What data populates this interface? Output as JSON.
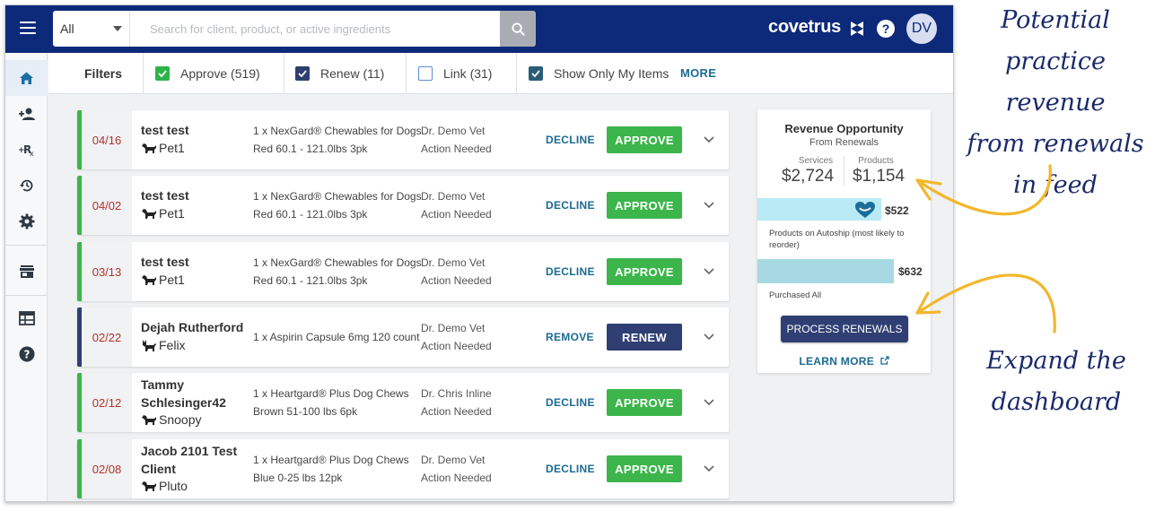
{
  "header": {
    "search_scope": "All",
    "search_placeholder": "Search for client, product, or active ingredients",
    "brand": "covetrus",
    "help_label": "?",
    "avatar_initials": "DV"
  },
  "filters": {
    "label": "Filters",
    "items": [
      {
        "label": "Approve (519)",
        "checked": true
      },
      {
        "label": "Renew (11)",
        "checked": true
      },
      {
        "label": "Link (31)",
        "checked": false
      },
      {
        "label": "Show Only My Items",
        "checked": true
      }
    ],
    "more": "MORE"
  },
  "rows": [
    {
      "date": "04/16",
      "client": "test test",
      "pet": "Pet1",
      "pet_type": "dog",
      "product1": "1 x NexGard® Chewables for Dogs",
      "product2": "Red 60.1 - 121.0lbs 3pk",
      "vet": "Dr. Demo Vet",
      "status": "Action Needed",
      "link": "DECLINE",
      "action": "APPROVE",
      "kind": "approve"
    },
    {
      "date": "04/02",
      "client": "test test",
      "pet": "Pet1",
      "pet_type": "dog",
      "product1": "1 x NexGard® Chewables for Dogs",
      "product2": "Red 60.1 - 121.0lbs 3pk",
      "vet": "Dr. Demo Vet",
      "status": "Action Needed",
      "link": "DECLINE",
      "action": "APPROVE",
      "kind": "approve"
    },
    {
      "date": "03/13",
      "client": "test test",
      "pet": "Pet1",
      "pet_type": "dog",
      "product1": "1 x NexGard® Chewables for Dogs",
      "product2": "Red 60.1 - 121.0lbs 3pk",
      "vet": "Dr. Demo Vet",
      "status": "Action Needed",
      "link": "DECLINE",
      "action": "APPROVE",
      "kind": "approve"
    },
    {
      "date": "02/22",
      "client": "Dejah Rutherford",
      "pet": "Felix",
      "pet_type": "cat",
      "product1": "1 x Aspirin Capsule 6mg 120 count",
      "product2": "",
      "vet": "Dr. Demo Vet",
      "status": "Action Needed",
      "link": "REMOVE",
      "action": "RENEW",
      "kind": "renew"
    },
    {
      "date": "02/12",
      "client": "Tammy Schlesinger42",
      "pet": "Snoopy",
      "pet_type": "dog",
      "product1": "1 x Heartgard® Plus Dog Chews",
      "product2": "Brown 51-100 lbs 6pk",
      "vet": "Dr. Chris Inline",
      "status": "Action Needed",
      "link": "DECLINE",
      "action": "APPROVE",
      "kind": "approve"
    },
    {
      "date": "02/08",
      "client": "Jacob 2101 Test Client",
      "pet": "Pluto",
      "pet_type": "dog",
      "product1": "1 x Heartgard® Plus Dog Chews",
      "product2": "Blue 0-25 lbs 12pk",
      "vet": "Dr. Demo Vet",
      "status": "Action Needed",
      "link": "DECLINE",
      "action": "APPROVE",
      "kind": "approve"
    }
  ],
  "revenue": {
    "title": "Revenue Opportunity",
    "subtitle": "From Renewals",
    "services_label": "Services",
    "services_value": "$2,724",
    "products_label": "Products",
    "products_value": "$1,154",
    "autoship_value": "$522",
    "autoship_label": "Products on Autoship (most likely to reorder)",
    "purchased_value": "$632",
    "purchased_label": "Purchased All",
    "process_button": "PROCESS RENEWALS",
    "learn_more": "LEARN MORE"
  },
  "annotations": {
    "top": [
      "Potential",
      "practice revenue",
      "from renewals",
      "in feed"
    ],
    "bottom": [
      "Expand the",
      "dashboard"
    ]
  },
  "colors": {
    "header": "#0d2a7a",
    "approve": "#3cb54a",
    "renew": "#2f3f73",
    "link": "#1b6a93",
    "date": "#b0332a",
    "annotation": "#1b2a6b",
    "arrow": "#f2b72e"
  }
}
